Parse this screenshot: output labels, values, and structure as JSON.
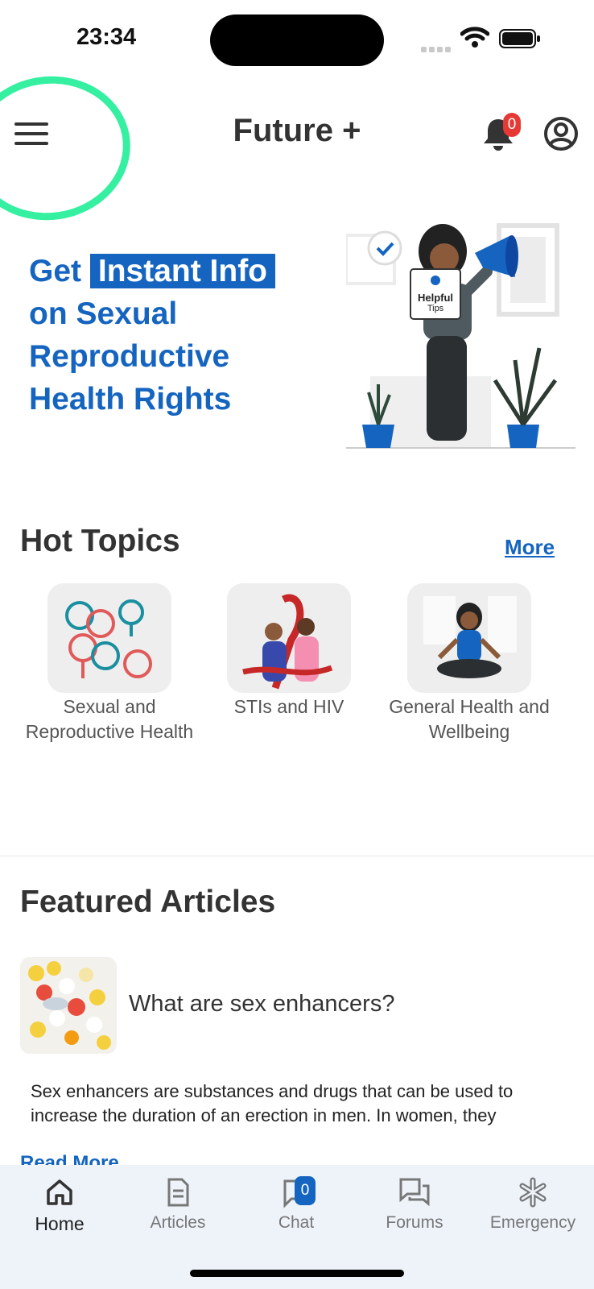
{
  "status_bar": {
    "time": "23:34"
  },
  "header": {
    "title": "Future +",
    "notification_count": "0"
  },
  "hero": {
    "line1_prefix": "Get",
    "line1_highlight": "Instant Info",
    "line2": "on Sexual",
    "line3": "Reproductive",
    "line4": "Health Rights",
    "sign_text": "Helpful",
    "sign_sub": "Tips"
  },
  "hot_topics": {
    "title": "Hot Topics",
    "more_label": "More",
    "items": [
      {
        "label": "Sexual and Reproductive Health"
      },
      {
        "label": "STIs and HIV"
      },
      {
        "label": "General  Health and Wellbeing"
      }
    ]
  },
  "featured": {
    "title": "Featured Articles",
    "article": {
      "title": "What are sex enhancers?",
      "excerpt": "Sex enhancers are substances and drugs that can be used to increase the duration of an erection in men. In women, they",
      "read_more": "Read More"
    }
  },
  "bottom_nav": {
    "items": [
      {
        "label": "Home",
        "icon": "home-icon"
      },
      {
        "label": "Articles",
        "icon": "document-icon"
      },
      {
        "label": "Chat",
        "icon": "chat-icon",
        "badge": "0"
      },
      {
        "label": "Forums",
        "icon": "forum-icon"
      },
      {
        "label": "Emergency",
        "icon": "asterisk-icon"
      }
    ]
  },
  "colors": {
    "accent": "#1565c0",
    "badge_red": "#e53935",
    "highlight_green": "#34f0a0"
  }
}
